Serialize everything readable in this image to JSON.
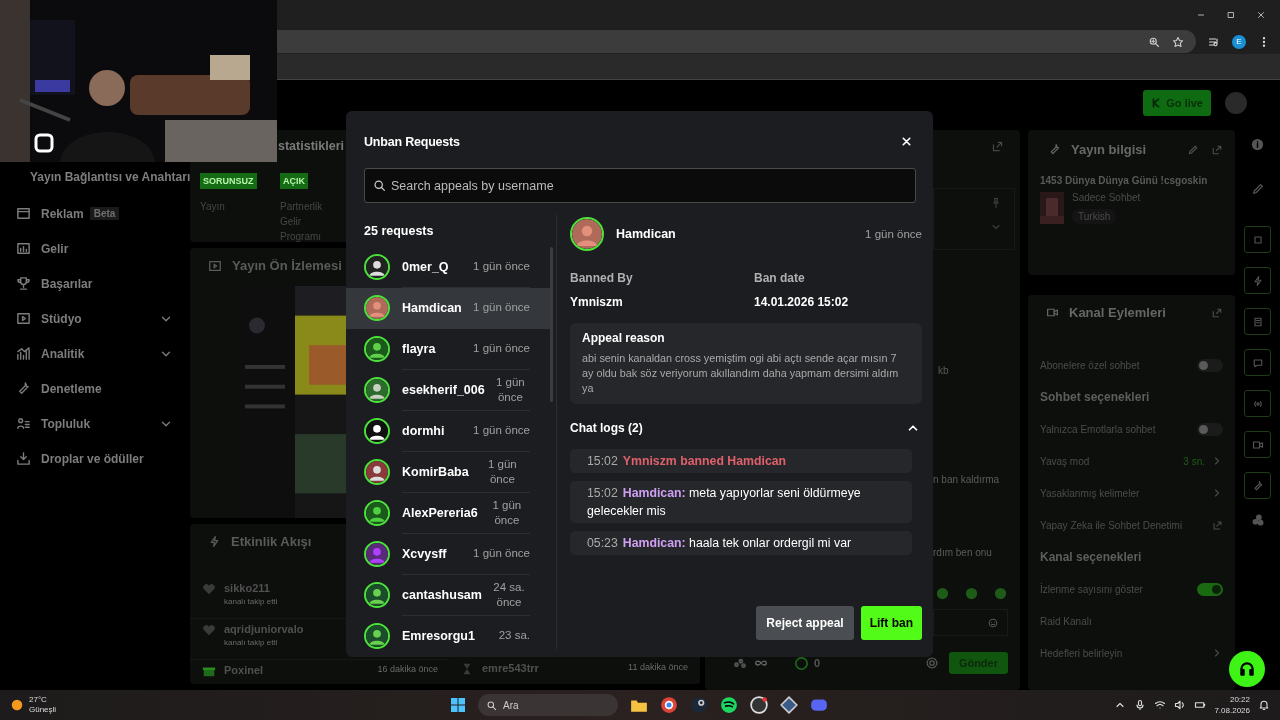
{
  "browser": {
    "profile_initial": "E"
  },
  "header": {
    "go_live": "Go live"
  },
  "sidebar": {
    "heading": "Yayın Bağlantısı ve Anahtarı",
    "items": [
      {
        "label": "Reklam",
        "badge": "Beta",
        "expandable": false
      },
      {
        "label": "Gelir",
        "expandable": false
      },
      {
        "label": "Başarılar",
        "expandable": false
      },
      {
        "label": "Stüdyo",
        "expandable": true
      },
      {
        "label": "Analitik",
        "expandable": true
      },
      {
        "label": "Denetleme",
        "expandable": false
      },
      {
        "label": "Topluluk",
        "expandable": true
      },
      {
        "label": "Droplar ve ödüller",
        "expandable": false
      }
    ]
  },
  "stats": {
    "title": "statistikleri",
    "badges": [
      {
        "label": "SORUNSUZ",
        "caption": "Yayın"
      },
      {
        "label": "AÇIK",
        "caption": "Partnerlik Gelir Programı"
      }
    ]
  },
  "preview": {
    "title": "Yayın Ön İzlemesi"
  },
  "events": {
    "title": "Etkinlik Akışı",
    "left": [
      {
        "kind": "follow",
        "user": "sikko211",
        "action": "kanalı takip etti"
      },
      {
        "kind": "follow",
        "user": "aqridjuniorvalo",
        "action": "kanalı takip etti"
      },
      {
        "kind": "gift",
        "user": "Poxinel",
        "time": "16 dakika önce"
      }
    ],
    "right": [
      {
        "kind": "sub",
        "user": "emre543trr",
        "time": "11 dakika önce"
      }
    ]
  },
  "chat": {
    "fragments": [
      "kb",
      "n ban kaldırma",
      "rdım ben onu"
    ],
    "count": "0",
    "send": "Gönder"
  },
  "stream_info": {
    "title": "Yayın bilgisi",
    "stream_title": "1453 Dünya Dünya Günü !csgoskin",
    "category": "Sadece Sohbet",
    "tag": "Turkish"
  },
  "channel_actions": {
    "title": "Kanal Eylemleri",
    "rows": [
      {
        "kind": "toggle",
        "label": "Abonelere özel sohbet",
        "on": false
      },
      {
        "kind": "header",
        "label": "Sohbet seçenekleri"
      },
      {
        "kind": "toggle",
        "label": "Yalnızca Emotlarla sohbet",
        "on": false
      },
      {
        "kind": "value",
        "label": "Yavaş mod",
        "value": "3 sn."
      },
      {
        "kind": "link",
        "label": "Yasaklanmış kelimeler"
      },
      {
        "kind": "external",
        "label": "Yapay Zeka ile Sohbet Denetimi"
      },
      {
        "kind": "header",
        "label": "Kanal seçenekleri"
      },
      {
        "kind": "toggle",
        "label": "İzlenme sayısını göster",
        "on": true
      },
      {
        "kind": "plain",
        "label": "Raid Kanalı"
      },
      {
        "kind": "link",
        "label": "Hedefleri belirleyin"
      }
    ]
  },
  "modal": {
    "title": "Unban Requests",
    "search": {
      "placeholder": "Search appeals by username"
    },
    "count": "25 requests",
    "requests": [
      {
        "name": "0mer_Q",
        "time": "1 gün önce",
        "selected": false
      },
      {
        "name": "Hamdican",
        "time": "1 gün önce",
        "selected": true
      },
      {
        "name": "flayra",
        "time": "1 gün önce",
        "selected": false
      },
      {
        "name": "esekherif_006",
        "time": "1 gün önce",
        "selected": false
      },
      {
        "name": "dormhi",
        "time": "1 gün önce",
        "selected": false
      },
      {
        "name": "KomirBaba",
        "time": "1 gün önce",
        "selected": false
      },
      {
        "name": "AlexPereria6",
        "time": "1 gün önce",
        "selected": false
      },
      {
        "name": "Xcvysff",
        "time": "1 gün önce",
        "selected": false
      },
      {
        "name": "cantashusam",
        "time": "24 sa. önce",
        "selected": false
      },
      {
        "name": "Emresorgu1",
        "time": "23 sa.",
        "selected": false
      }
    ],
    "detail": {
      "name": "Hamdican",
      "time": "1 gün önce",
      "banned_by_label": "Banned By",
      "banned_by": "Ymniszm",
      "ban_date_label": "Ban date",
      "ban_date": "14.01.2026 15:02",
      "appeal_title": "Appeal reason",
      "appeal_text": "abi senin kanaldan cross yemiştim ogi abi açtı sende açar mısın 7 ay oldu bak söz veriyorum akıllandım daha yapmam dersimi aldım ya"
    },
    "chat_logs": {
      "title": "Chat logs (2)",
      "expanded": true,
      "entries": [
        {
          "kind": "system",
          "time": "15:02",
          "text": "Ymniszm banned Hamdican"
        },
        {
          "kind": "message",
          "time": "15:02",
          "user": "Hamdican:",
          "text": "meta yapıyorlar seni öldürmeye gelecekler mis"
        },
        {
          "kind": "message",
          "time": "05:23",
          "user": "Hamdican:",
          "text": "haala tek onlar ordergil mi var"
        }
      ]
    },
    "buttons": {
      "reject": "Reject appeal",
      "lift": "Lift ban"
    }
  },
  "taskbar": {
    "temperature": "27°C",
    "weather": "Güneşli",
    "search": "Ara",
    "time": "20:22",
    "date": "7.08.2026"
  }
}
